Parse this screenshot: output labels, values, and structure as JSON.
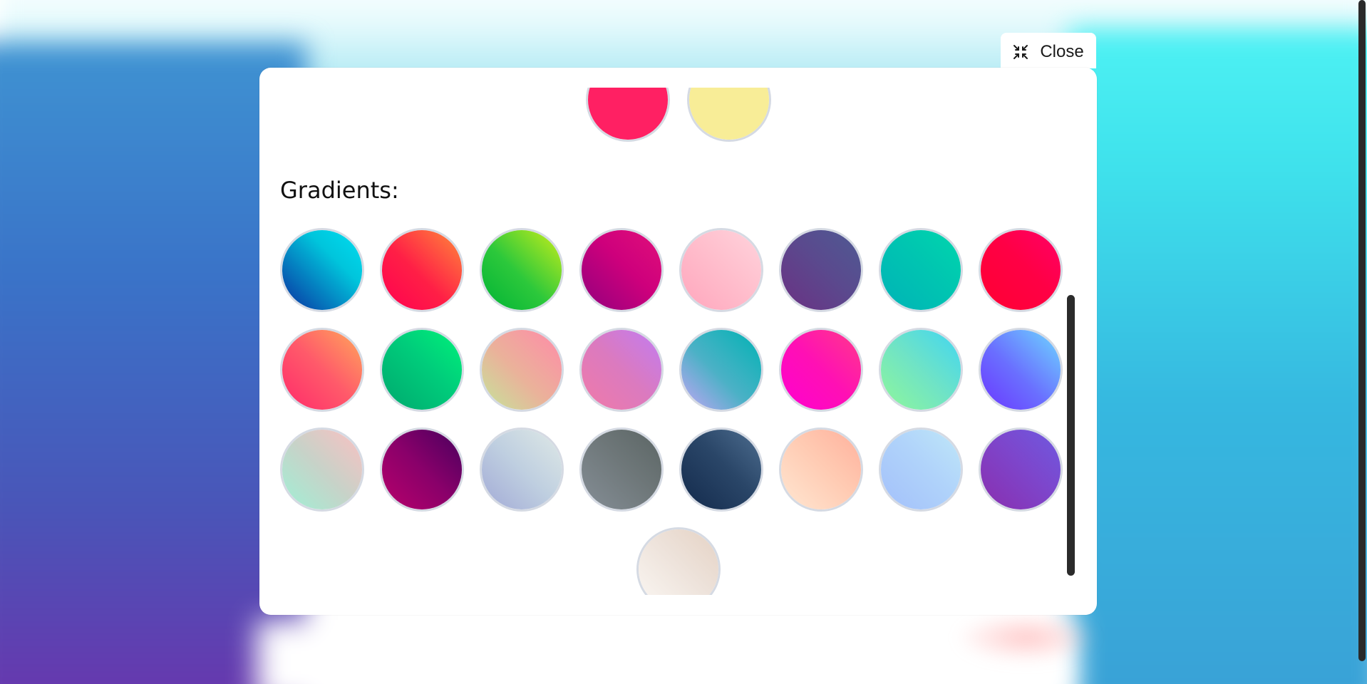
{
  "close_button": {
    "label": "Close",
    "icon": "collapse-icon"
  },
  "section_title": "Gradients:",
  "solid_colors": [
    {
      "fill": "#ff2063"
    },
    {
      "fill": "#f8ed97"
    }
  ],
  "gradients": [
    {
      "fill": "linear-gradient(45deg, #0a2fa0, #00c5dc 65%, #00def0)"
    },
    {
      "fill": "linear-gradient(45deg, #ff0050, #ff1f46 45%, #ff8a3a)"
    },
    {
      "fill": "linear-gradient(45deg, #00b336, #2cc83b 45%, #c9ee1a)"
    },
    {
      "fill": "linear-gradient(45deg, #92007e, #ce007c 55%, #e0107a)"
    },
    {
      "fill": "linear-gradient(45deg, #ffa6bd, #ffbfcd 55%, #ffd3dc)"
    },
    {
      "fill": "linear-gradient(45deg, #6b3183, #5a4a8e 55%, #4e5a93)"
    },
    {
      "fill": "linear-gradient(45deg, #00b3b7, #00c5b1 55%, #00d6ad)"
    },
    {
      "fill": "linear-gradient(45deg, #ff0033, #ff0045 55%, #ff0066)"
    },
    {
      "fill": "linear-gradient(45deg, #ff2a6a, #ff5a6a 50%, #ffa85a)"
    },
    {
      "fill": "linear-gradient(45deg, #00a86e, #00cc7b 55%, #00f27a)"
    },
    {
      "fill": "linear-gradient(45deg, #c4e59a, #eab29a 45%, #ff8aa8)"
    },
    {
      "fill": "linear-gradient(45deg, #f07aa8, #db7abf 50%, #c17cf2)"
    },
    {
      "fill": "linear-gradient(45deg, #c4a5f5, #4bb1c6 45%, #00b3b4)"
    },
    {
      "fill": "linear-gradient(45deg, #ff00d0, #ff10b4 50%, #ff3a8a)"
    },
    {
      "fill": "linear-gradient(45deg, #8ff79a, #6fe3c6 50%, #40d6f2)"
    },
    {
      "fill": "linear-gradient(45deg, #6b36ff, #6a6fff 45%, #6ed8ff)"
    },
    {
      "fill": "linear-gradient(45deg, #9ff0d5, #c8d2c8 50%, #fbc0c2)"
    },
    {
      "fill": "linear-gradient(45deg, #b8006c, #8a006a 50%, #48005e)"
    },
    {
      "fill": "linear-gradient(45deg, #a2aad6, #bfcfe0 50%, #dfe9e6)"
    },
    {
      "fill": "linear-gradient(45deg, #858e96, #6e7779 55%, #5b6564)"
    },
    {
      "fill": "linear-gradient(45deg, #132a4c, #2a4668 55%, #4e6e90)"
    },
    {
      "fill": "linear-gradient(45deg, #ffe7d2, #ffcab2 55%, #ffb09c)"
    },
    {
      "fill": "linear-gradient(45deg, #a3c0fb, #b0d3fa 55%, #bfe7f8)"
    },
    {
      "fill": "linear-gradient(45deg, #8a2eae, #7d46cc 55%, #6e5ae0)"
    }
  ],
  "last_gradient": {
    "fill": "linear-gradient(45deg, #fbf7f3, #ede2da 55%, #e5d2c4)"
  }
}
